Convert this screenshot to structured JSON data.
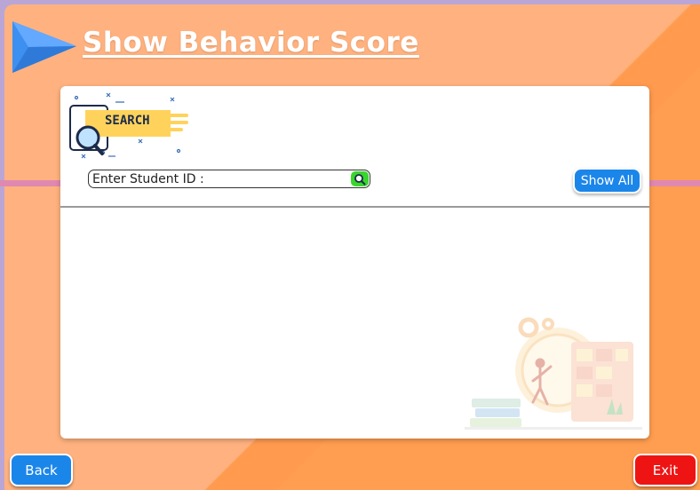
{
  "header": {
    "title": "Show Behavior Score"
  },
  "search": {
    "logo_text": "SEARCH",
    "placeholder": "Enter Student ID :",
    "value": ""
  },
  "buttons": {
    "show_all": "Show All",
    "back": "Back",
    "exit": "Exit"
  },
  "colors": {
    "background": "#ffb27f",
    "accent_blue": "#1b86ea",
    "exit_red": "#ef1414",
    "search_green": "#39d62e",
    "pink_line": "#e089b0"
  },
  "icons": [
    "play-arrow-icon",
    "search-logo-icon",
    "magnifier-icon",
    "deadline-illustration"
  ]
}
